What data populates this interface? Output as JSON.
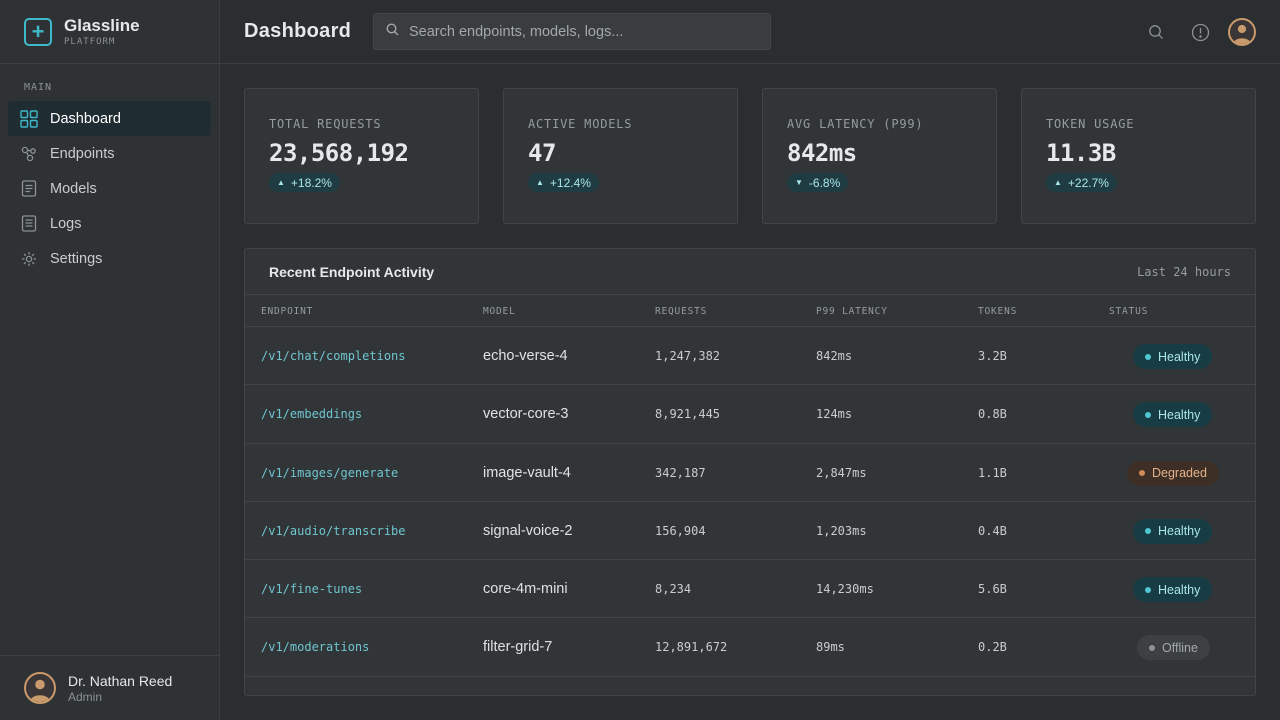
{
  "brand": {
    "name": "Glassline",
    "subtitle": "PLATFORM"
  },
  "sidebar": {
    "section_label": "MAIN",
    "items": [
      {
        "label": "Dashboard",
        "icon": "grid-icon",
        "active": true
      },
      {
        "label": "Endpoints",
        "icon": "nodes-icon",
        "active": false
      },
      {
        "label": "Models",
        "icon": "document-icon",
        "active": false
      },
      {
        "label": "Logs",
        "icon": "log-icon",
        "active": false
      },
      {
        "label": "Settings",
        "icon": "gear-icon",
        "active": false
      }
    ]
  },
  "user": {
    "name": "Dr. Nathan Reed",
    "role": "Admin"
  },
  "header": {
    "title": "Dashboard",
    "search_placeholder": "Search endpoints, models, logs..."
  },
  "stats": [
    {
      "label": "TOTAL REQUESTS",
      "value": "23,568,192",
      "delta": "+18.2%",
      "direction": "up"
    },
    {
      "label": "ACTIVE MODELS",
      "value": "47",
      "delta": "+12.4%",
      "direction": "up"
    },
    {
      "label": "AVG LATENCY (P99)",
      "value": "842ms",
      "delta": "-6.8%",
      "direction": "down"
    },
    {
      "label": "TOKEN USAGE",
      "value": "11.3B",
      "delta": "+22.7%",
      "direction": "up"
    }
  ],
  "activity": {
    "title": "Recent Endpoint Activity",
    "range": "Last 24 hours",
    "columns": [
      "ENDPOINT",
      "MODEL",
      "REQUESTS",
      "P99 LATENCY",
      "TOKENS",
      "STATUS"
    ],
    "rows": [
      {
        "endpoint": "/v1/chat/completions",
        "model": "echo-verse-4",
        "requests": "1,247,382",
        "latency": "842ms",
        "tokens": "3.2B",
        "status": "Healthy"
      },
      {
        "endpoint": "/v1/embeddings",
        "model": "vector-core-3",
        "requests": "8,921,445",
        "latency": "124ms",
        "tokens": "0.8B",
        "status": "Healthy"
      },
      {
        "endpoint": "/v1/images/generate",
        "model": "image-vault-4",
        "requests": "342,187",
        "latency": "2,847ms",
        "tokens": "1.1B",
        "status": "Degraded"
      },
      {
        "endpoint": "/v1/audio/transcribe",
        "model": "signal-voice-2",
        "requests": "156,904",
        "latency": "1,203ms",
        "tokens": "0.4B",
        "status": "Healthy"
      },
      {
        "endpoint": "/v1/fine-tunes",
        "model": "core-4m-mini",
        "requests": "8,234",
        "latency": "14,230ms",
        "tokens": "5.6B",
        "status": "Healthy"
      },
      {
        "endpoint": "/v1/moderations",
        "model": "filter-grid-7",
        "requests": "12,891,672",
        "latency": "89ms",
        "tokens": "0.2B",
        "status": "Offline"
      }
    ]
  },
  "colors": {
    "accent": "#3fb9c7",
    "healthy": "#4fc6d2",
    "degraded": "#d2895b",
    "offline": "#8c9295"
  }
}
